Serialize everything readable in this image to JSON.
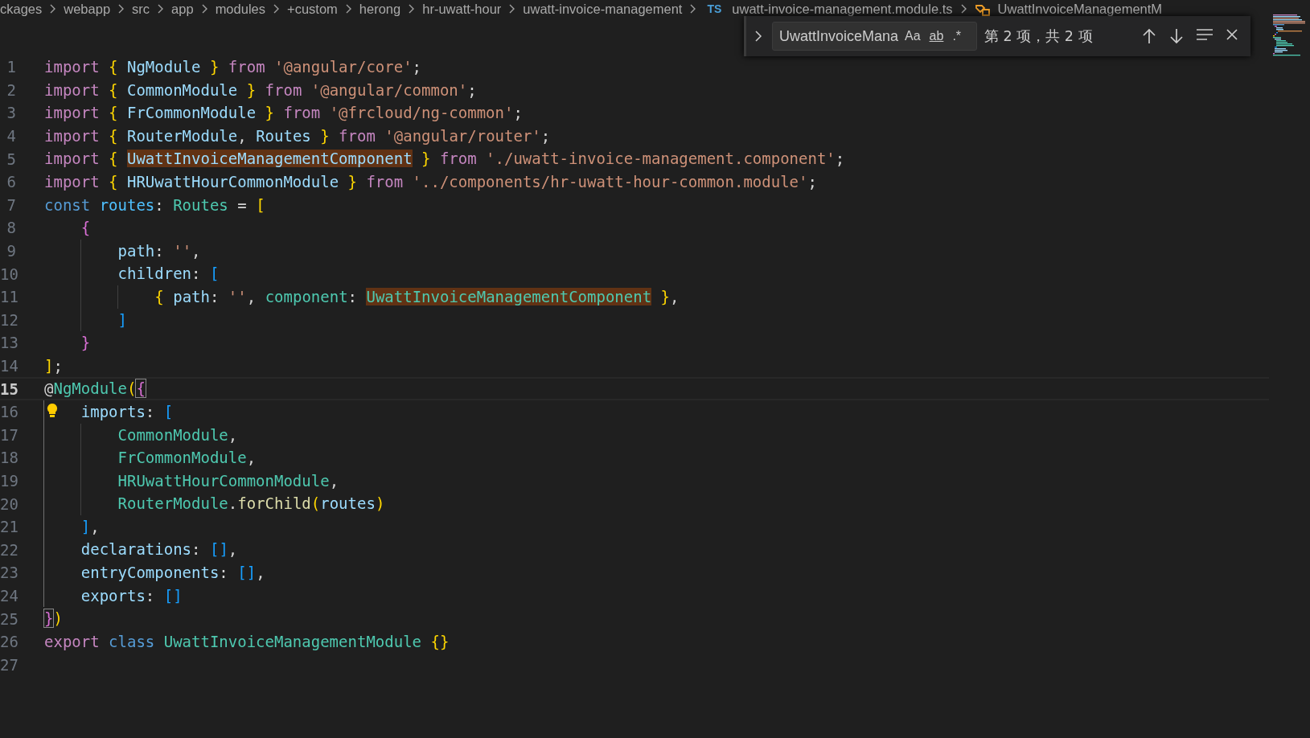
{
  "breadcrumb": {
    "segments": [
      "ckages",
      "webapp",
      "src",
      "app",
      "modules",
      "+custom",
      "herong",
      "hr-uwatt-hour",
      "uwatt-invoice-management"
    ],
    "file": {
      "badge": "TS",
      "name": "uwatt-invoice-management.module.ts"
    },
    "symbol": "UwattInvoiceManagementM"
  },
  "find_widget": {
    "value": "UwattInvoiceMana",
    "options": [
      {
        "label": "Aa",
        "on": false
      },
      {
        "label": "ab",
        "on": false
      },
      {
        "label": ".*",
        "on": false
      }
    ],
    "result": "第 2 项，共 2 项"
  },
  "editor": {
    "lines": [
      {
        "number": "1",
        "current": false,
        "active_guide": false,
        "lightbulb": false,
        "tokens": [
          {
            "text": "import ",
            "kind": "keyword"
          },
          {
            "text": "{ ",
            "kind": "bracket-1"
          },
          {
            "text": "NgModule",
            "kind": "variable"
          },
          {
            "text": " } ",
            "kind": "bracket-1"
          },
          {
            "text": "from ",
            "kind": "keyword"
          },
          {
            "text": "'@angular/core'",
            "kind": "string"
          },
          {
            "text": ";",
            "kind": "plain"
          }
        ]
      },
      {
        "number": "2",
        "current": false,
        "active_guide": false,
        "lightbulb": false,
        "tokens": [
          {
            "text": "import ",
            "kind": "keyword"
          },
          {
            "text": "{ ",
            "kind": "bracket-1"
          },
          {
            "text": "CommonModule",
            "kind": "variable"
          },
          {
            "text": " } ",
            "kind": "bracket-1"
          },
          {
            "text": "from ",
            "kind": "keyword"
          },
          {
            "text": "'@angular/common'",
            "kind": "string"
          },
          {
            "text": ";",
            "kind": "plain"
          }
        ]
      },
      {
        "number": "3",
        "current": false,
        "active_guide": false,
        "lightbulb": false,
        "tokens": [
          {
            "text": "import ",
            "kind": "keyword"
          },
          {
            "text": "{ ",
            "kind": "bracket-1"
          },
          {
            "text": "FrCommonModule",
            "kind": "variable"
          },
          {
            "text": " } ",
            "kind": "bracket-1"
          },
          {
            "text": "from ",
            "kind": "keyword"
          },
          {
            "text": "'@frcloud/ng-common'",
            "kind": "string"
          },
          {
            "text": ";",
            "kind": "plain"
          }
        ]
      },
      {
        "number": "4",
        "current": false,
        "active_guide": false,
        "lightbulb": false,
        "tokens": [
          {
            "text": "import ",
            "kind": "keyword"
          },
          {
            "text": "{ ",
            "kind": "bracket-1"
          },
          {
            "text": "RouterModule",
            "kind": "variable"
          },
          {
            "text": ", ",
            "kind": "plain"
          },
          {
            "text": "Routes",
            "kind": "variable"
          },
          {
            "text": " } ",
            "kind": "bracket-1"
          },
          {
            "text": "from ",
            "kind": "keyword"
          },
          {
            "text": "'@angular/router'",
            "kind": "string"
          },
          {
            "text": ";",
            "kind": "plain"
          }
        ]
      },
      {
        "number": "5",
        "current": false,
        "active_guide": false,
        "lightbulb": false,
        "tokens": [
          {
            "text": "import ",
            "kind": "keyword"
          },
          {
            "text": "{ ",
            "kind": "bracket-1"
          },
          {
            "text": "UwattInvoiceManagementComponent",
            "kind": "variable-match"
          },
          {
            "text": " } ",
            "kind": "bracket-1"
          },
          {
            "text": "from ",
            "kind": "keyword"
          },
          {
            "text": "'./uwatt-invoice-management.component'",
            "kind": "string"
          },
          {
            "text": ";",
            "kind": "plain"
          }
        ]
      },
      {
        "number": "6",
        "current": false,
        "active_guide": false,
        "lightbulb": false,
        "tokens": [
          {
            "text": "import ",
            "kind": "keyword"
          },
          {
            "text": "{ ",
            "kind": "bracket-1"
          },
          {
            "text": "HRUwattHourCommonModule",
            "kind": "variable"
          },
          {
            "text": " } ",
            "kind": "bracket-1"
          },
          {
            "text": "from ",
            "kind": "keyword"
          },
          {
            "text": "'../components/hr-uwatt-hour-common.module'",
            "kind": "string"
          },
          {
            "text": ";",
            "kind": "plain"
          }
        ]
      },
      {
        "number": "7",
        "current": false,
        "active_guide": false,
        "lightbulb": false,
        "tokens": [
          {
            "text": "const ",
            "kind": "storage"
          },
          {
            "text": "routes",
            "kind": "constant"
          },
          {
            "text": ": ",
            "kind": "plain"
          },
          {
            "text": "Routes",
            "kind": "type"
          },
          {
            "text": " = ",
            "kind": "plain"
          },
          {
            "text": "[",
            "kind": "bracket-1"
          }
        ]
      },
      {
        "number": "8",
        "current": false,
        "active_guide": false,
        "lightbulb": false,
        "tokens": [
          {
            "text": "    {",
            "kind": "bracket-2"
          }
        ]
      },
      {
        "number": "9",
        "current": false,
        "active_guide": false,
        "lightbulb": false,
        "tokens": [
          {
            "text": "        path",
            "kind": "variable"
          },
          {
            "text": ": ",
            "kind": "plain"
          },
          {
            "text": "''",
            "kind": "string"
          },
          {
            "text": ",",
            "kind": "plain"
          }
        ]
      },
      {
        "number": "10",
        "current": false,
        "active_guide": false,
        "lightbulb": false,
        "tokens": [
          {
            "text": "        children",
            "kind": "variable"
          },
          {
            "text": ": ",
            "kind": "plain"
          },
          {
            "text": "[",
            "kind": "bracket-3"
          }
        ]
      },
      {
        "number": "11",
        "current": false,
        "active_guide": false,
        "lightbulb": false,
        "tokens": [
          {
            "text": "            { ",
            "kind": "bracket-1"
          },
          {
            "text": "path",
            "kind": "variable"
          },
          {
            "text": ": ",
            "kind": "plain"
          },
          {
            "text": "''",
            "kind": "string"
          },
          {
            "text": ", ",
            "kind": "plain"
          },
          {
            "text": "component",
            "kind": "type"
          },
          {
            "text": ": ",
            "kind": "plain"
          },
          {
            "text": "UwattInvoiceManagementComponent",
            "kind": "type-match"
          },
          {
            "text": " }",
            "kind": "bracket-1"
          },
          {
            "text": ",",
            "kind": "plain"
          }
        ]
      },
      {
        "number": "12",
        "current": false,
        "active_guide": false,
        "lightbulb": false,
        "tokens": [
          {
            "text": "        ]",
            "kind": "bracket-3"
          }
        ]
      },
      {
        "number": "13",
        "current": false,
        "active_guide": false,
        "lightbulb": false,
        "tokens": [
          {
            "text": "    }",
            "kind": "bracket-2"
          }
        ]
      },
      {
        "number": "14",
        "current": false,
        "active_guide": false,
        "lightbulb": false,
        "tokens": [
          {
            "text": "]",
            "kind": "bracket-1"
          },
          {
            "text": ";",
            "kind": "plain"
          }
        ]
      },
      {
        "number": "15",
        "current": true,
        "active_guide": false,
        "lightbulb": false,
        "tokens": [
          {
            "text": "@",
            "kind": "plain"
          },
          {
            "text": "NgModule",
            "kind": "type"
          },
          {
            "text": "(",
            "kind": "bracket-1"
          },
          {
            "text": "{",
            "kind": "bracket-2-boxed"
          }
        ]
      },
      {
        "number": "16",
        "current": false,
        "active_guide": true,
        "lightbulb": true,
        "tokens": [
          {
            "text": "    imports",
            "kind": "variable"
          },
          {
            "text": ": ",
            "kind": "plain"
          },
          {
            "text": "[",
            "kind": "bracket-3"
          }
        ]
      },
      {
        "number": "17",
        "current": false,
        "active_guide": true,
        "lightbulb": false,
        "tokens": [
          {
            "text": "        CommonModule",
            "kind": "type"
          },
          {
            "text": ",",
            "kind": "plain"
          }
        ]
      },
      {
        "number": "18",
        "current": false,
        "active_guide": true,
        "lightbulb": false,
        "tokens": [
          {
            "text": "        FrCommonModule",
            "kind": "type"
          },
          {
            "text": ",",
            "kind": "plain"
          }
        ]
      },
      {
        "number": "19",
        "current": false,
        "active_guide": true,
        "lightbulb": false,
        "tokens": [
          {
            "text": "        HRUwattHourCommonModule",
            "kind": "type"
          },
          {
            "text": ",",
            "kind": "plain"
          }
        ]
      },
      {
        "number": "20",
        "current": false,
        "active_guide": true,
        "lightbulb": false,
        "tokens": [
          {
            "text": "        RouterModule",
            "kind": "type"
          },
          {
            "text": ".",
            "kind": "plain"
          },
          {
            "text": "forChild",
            "kind": "function"
          },
          {
            "text": "(",
            "kind": "bracket-1"
          },
          {
            "text": "routes",
            "kind": "variable"
          },
          {
            "text": ")",
            "kind": "bracket-1"
          }
        ]
      },
      {
        "number": "21",
        "current": false,
        "active_guide": true,
        "lightbulb": false,
        "tokens": [
          {
            "text": "    ]",
            "kind": "bracket-3"
          },
          {
            "text": ",",
            "kind": "plain"
          }
        ]
      },
      {
        "number": "22",
        "current": false,
        "active_guide": true,
        "lightbulb": false,
        "tokens": [
          {
            "text": "    declarations",
            "kind": "variable"
          },
          {
            "text": ": ",
            "kind": "plain"
          },
          {
            "text": "[]",
            "kind": "bracket-3"
          },
          {
            "text": ",",
            "kind": "plain"
          }
        ]
      },
      {
        "number": "23",
        "current": false,
        "active_guide": true,
        "lightbulb": false,
        "tokens": [
          {
            "text": "    entryComponents",
            "kind": "variable"
          },
          {
            "text": ": ",
            "kind": "plain"
          },
          {
            "text": "[]",
            "kind": "bracket-3"
          },
          {
            "text": ",",
            "kind": "plain"
          }
        ]
      },
      {
        "number": "24",
        "current": false,
        "active_guide": true,
        "lightbulb": false,
        "tokens": [
          {
            "text": "    exports",
            "kind": "variable"
          },
          {
            "text": ": ",
            "kind": "plain"
          },
          {
            "text": "[]",
            "kind": "bracket-3"
          }
        ]
      },
      {
        "number": "25",
        "current": false,
        "active_guide": false,
        "lightbulb": false,
        "tokens": [
          {
            "text": "}",
            "kind": "bracket-2-boxed"
          },
          {
            "text": ")",
            "kind": "bracket-1"
          }
        ]
      },
      {
        "number": "26",
        "current": false,
        "active_guide": false,
        "lightbulb": false,
        "tokens": [
          {
            "text": "export ",
            "kind": "keyword"
          },
          {
            "text": "class ",
            "kind": "storage"
          },
          {
            "text": "UwattInvoiceManagementModule",
            "kind": "type"
          },
          {
            "text": " {}",
            "kind": "bracket-1"
          }
        ]
      },
      {
        "number": "27",
        "current": false,
        "active_guide": false,
        "lightbulb": false
      }
    ]
  }
}
